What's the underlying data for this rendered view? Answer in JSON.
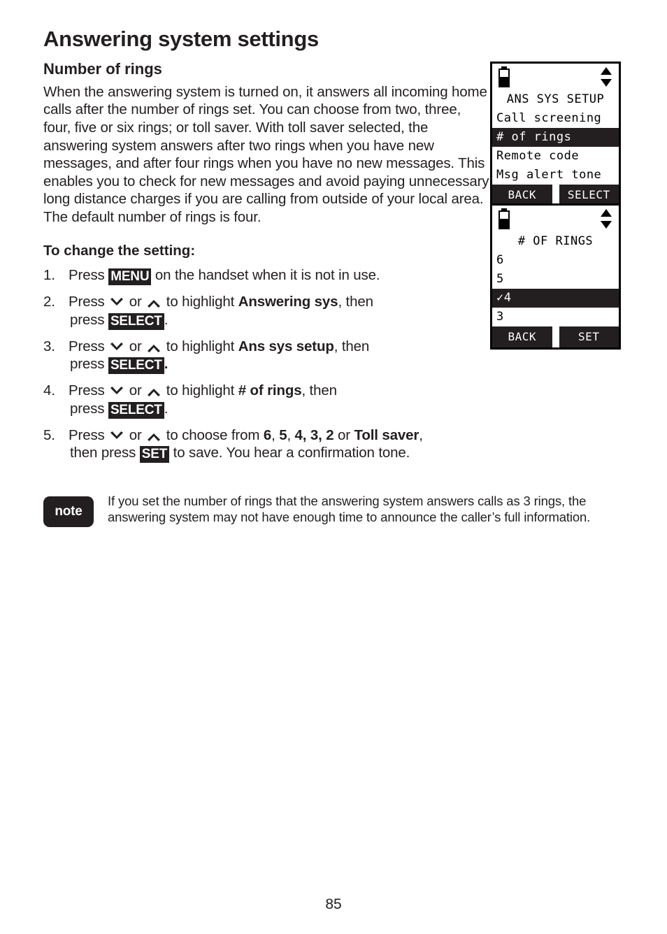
{
  "document": {
    "title": "Answering system settings",
    "section_title": "Number of rings",
    "intro_paragraph": "When the answering system is turned on, it answers all incoming home calls after the number of rings set. You can choose from two, three, four, five or six rings; or toll saver. With toll saver selected, the answering system answers after two rings when you have new messages, and after four rings when you have no new messages. This enables you to check for new messages and avoid paying unnecessary long distance charges if you are calling from outside of your local area. The default number of rings is four.",
    "procedure_heading": "To change the setting:",
    "page_number": "85"
  },
  "steps": [
    {
      "number": "1.",
      "pre": "Press ",
      "key": "MENU",
      "post": " on the handset when it is not in use."
    },
    {
      "number": "2.",
      "pre": "Press ",
      "mid": " or ",
      "after_arrows": " to highlight ",
      "bold_target": "Answering sys",
      "tail": ", then",
      "line2_pre": "press ",
      "line2_key": "SELECT",
      "line2_post": "."
    },
    {
      "number": "3.",
      "pre": "Press ",
      "mid": " or ",
      "after_arrows": " to highlight ",
      "bold_target": "Ans sys setup",
      "tail": ", then",
      "line2_pre": "press ",
      "line2_key": "SELECT",
      "line2_post": "."
    },
    {
      "number": "4.",
      "pre": "Press ",
      "mid": " or ",
      "after_arrows": " to highlight ",
      "bold_target": "# of rings",
      "tail": ", then",
      "line2_pre": "press ",
      "line2_key": "SELECT",
      "line2_post": "."
    },
    {
      "number": "5.",
      "pre": "Press ",
      "mid": " or ",
      "after_arrows": " to choose from ",
      "choice_1": "6",
      "sep_1": ", ",
      "choice_2": "5",
      "sep_2": ", ",
      "choice_3": "4, 3, 2",
      "sep_3": " or ",
      "choice_4": "Toll saver",
      "tail": ",",
      "line2_pre": "then press ",
      "line2_key": "SET",
      "line2_post": " to save. You hear a confirmation tone."
    }
  ],
  "note": {
    "badge_label": "note",
    "text": "If you set the number of rings that the answering system answers calls as 3 rings, the answering system may not have enough time to announce the caller’s full information."
  },
  "lcd_screens": [
    {
      "id": "ans-sys-setup",
      "status": {
        "battery_icon": "battery-icon",
        "scroll_icon": "scroll-up-down-icon"
      },
      "title": "ANS SYS SETUP",
      "menu_items": [
        {
          "label": "Call screening",
          "selected": false
        },
        {
          "label": "# of rings",
          "selected": true
        },
        {
          "label": "Remote code",
          "selected": false
        },
        {
          "label": "Msg alert tone",
          "selected": false
        }
      ],
      "softkeys": {
        "left": "BACK",
        "right": "SELECT"
      }
    },
    {
      "id": "number-of-rings",
      "status": {
        "battery_icon": "battery-icon",
        "scroll_icon": "scroll-up-down-icon"
      },
      "title": "# OF RINGS",
      "menu_items": [
        {
          "label": "6",
          "selected": false
        },
        {
          "label": "5",
          "selected": false
        },
        {
          "label": "✓4",
          "selected": true
        },
        {
          "label": "3",
          "selected": false
        }
      ],
      "softkeys": {
        "left": "BACK",
        "right": "SET"
      }
    }
  ],
  "colors": {
    "text": "#231f20",
    "invert_bg": "#231f20",
    "invert_fg": "#ffffff",
    "page_bg": "#ffffff"
  }
}
